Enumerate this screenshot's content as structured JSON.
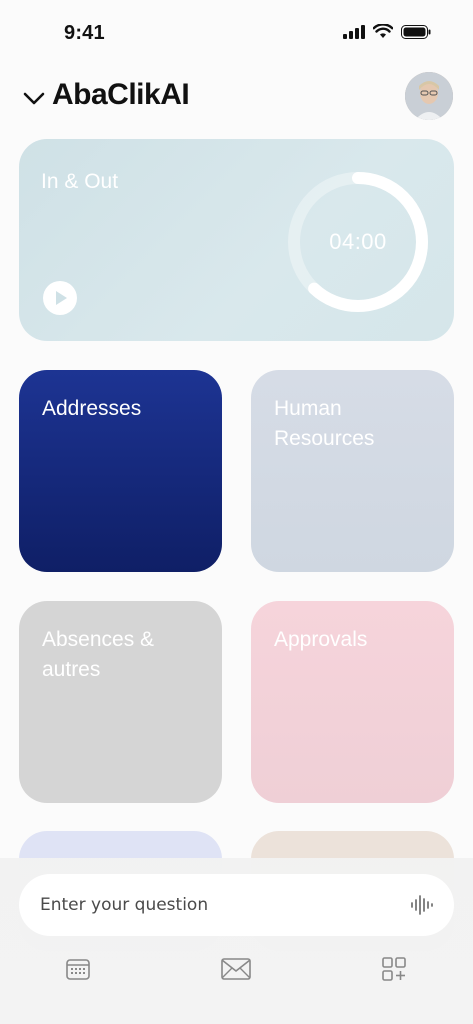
{
  "status_bar": {
    "time": "9:41"
  },
  "header": {
    "title": "AbaClikAI"
  },
  "cards": {
    "in_out": {
      "title": "In & Out",
      "timer": "04:00",
      "timer_progress": 0.62
    },
    "addresses": {
      "title": "Addresses"
    },
    "human_resources": {
      "title": "Human Resources"
    },
    "absences": {
      "title": "Absences & autres"
    },
    "approvals": {
      "title": "Approvals"
    }
  },
  "assistant": {
    "placeholder": "Enter your question"
  },
  "tabbar": {
    "items": [
      "calendar-icon",
      "mail-icon",
      "apps-add-icon"
    ]
  },
  "colors": {
    "addresses": "#15287a",
    "in_out": "#d5e6ea",
    "approvals": "#f3d1d8",
    "human_resources": "#d3dae4",
    "absences": "#d5d5d5"
  }
}
